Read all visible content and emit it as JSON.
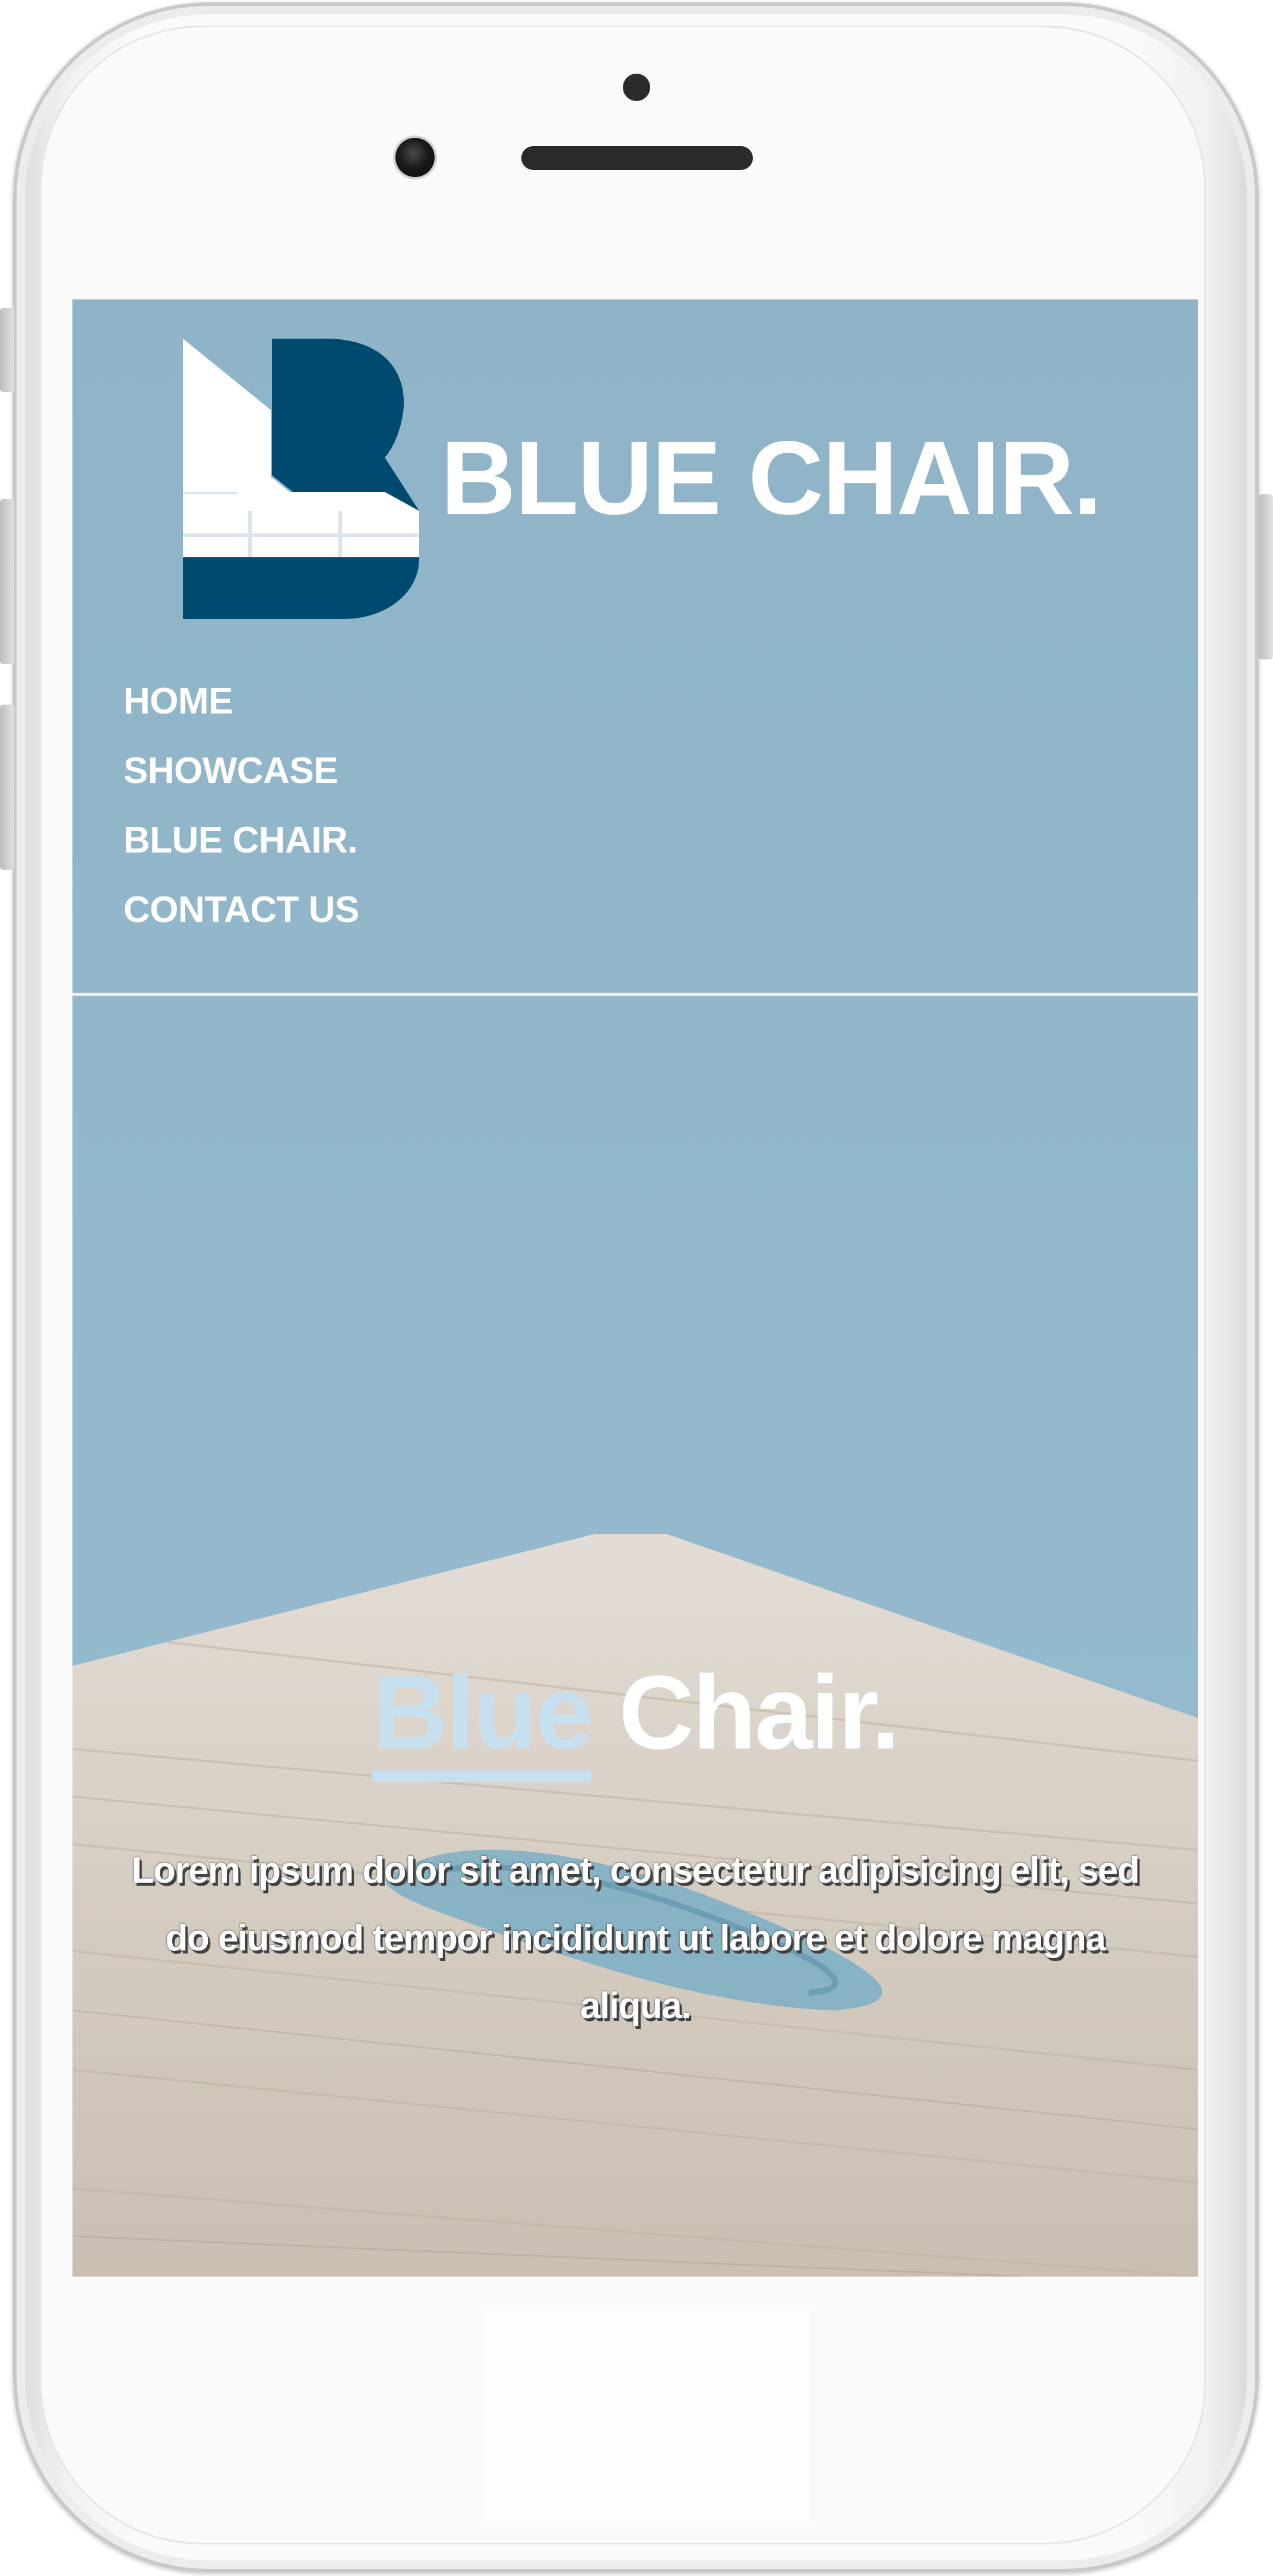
{
  "brand": {
    "name": "BLUE CHAIR.",
    "logo_icon": "blue-chair-b-logo-icon"
  },
  "nav": {
    "items": [
      {
        "label": "HOME"
      },
      {
        "label": "SHOWCASE"
      },
      {
        "label": "BLUE CHAIR."
      },
      {
        "label": "CONTACT US"
      }
    ]
  },
  "hero": {
    "title_accent": "Blue",
    "title_rest": "Chair.",
    "text": "Lorem ipsum dolor sit amet, consectetur adipisicing elit, sed do eiusmod tempor incididunt ut labore et dolore magna aliqua."
  },
  "colors": {
    "sky_blue": "#92b7ca",
    "brand_navy": "#004a70",
    "accent_light_blue": "#c6e0ef",
    "text_white": "#ffffff"
  },
  "device": {
    "type": "phone-mockup",
    "color": "white"
  }
}
